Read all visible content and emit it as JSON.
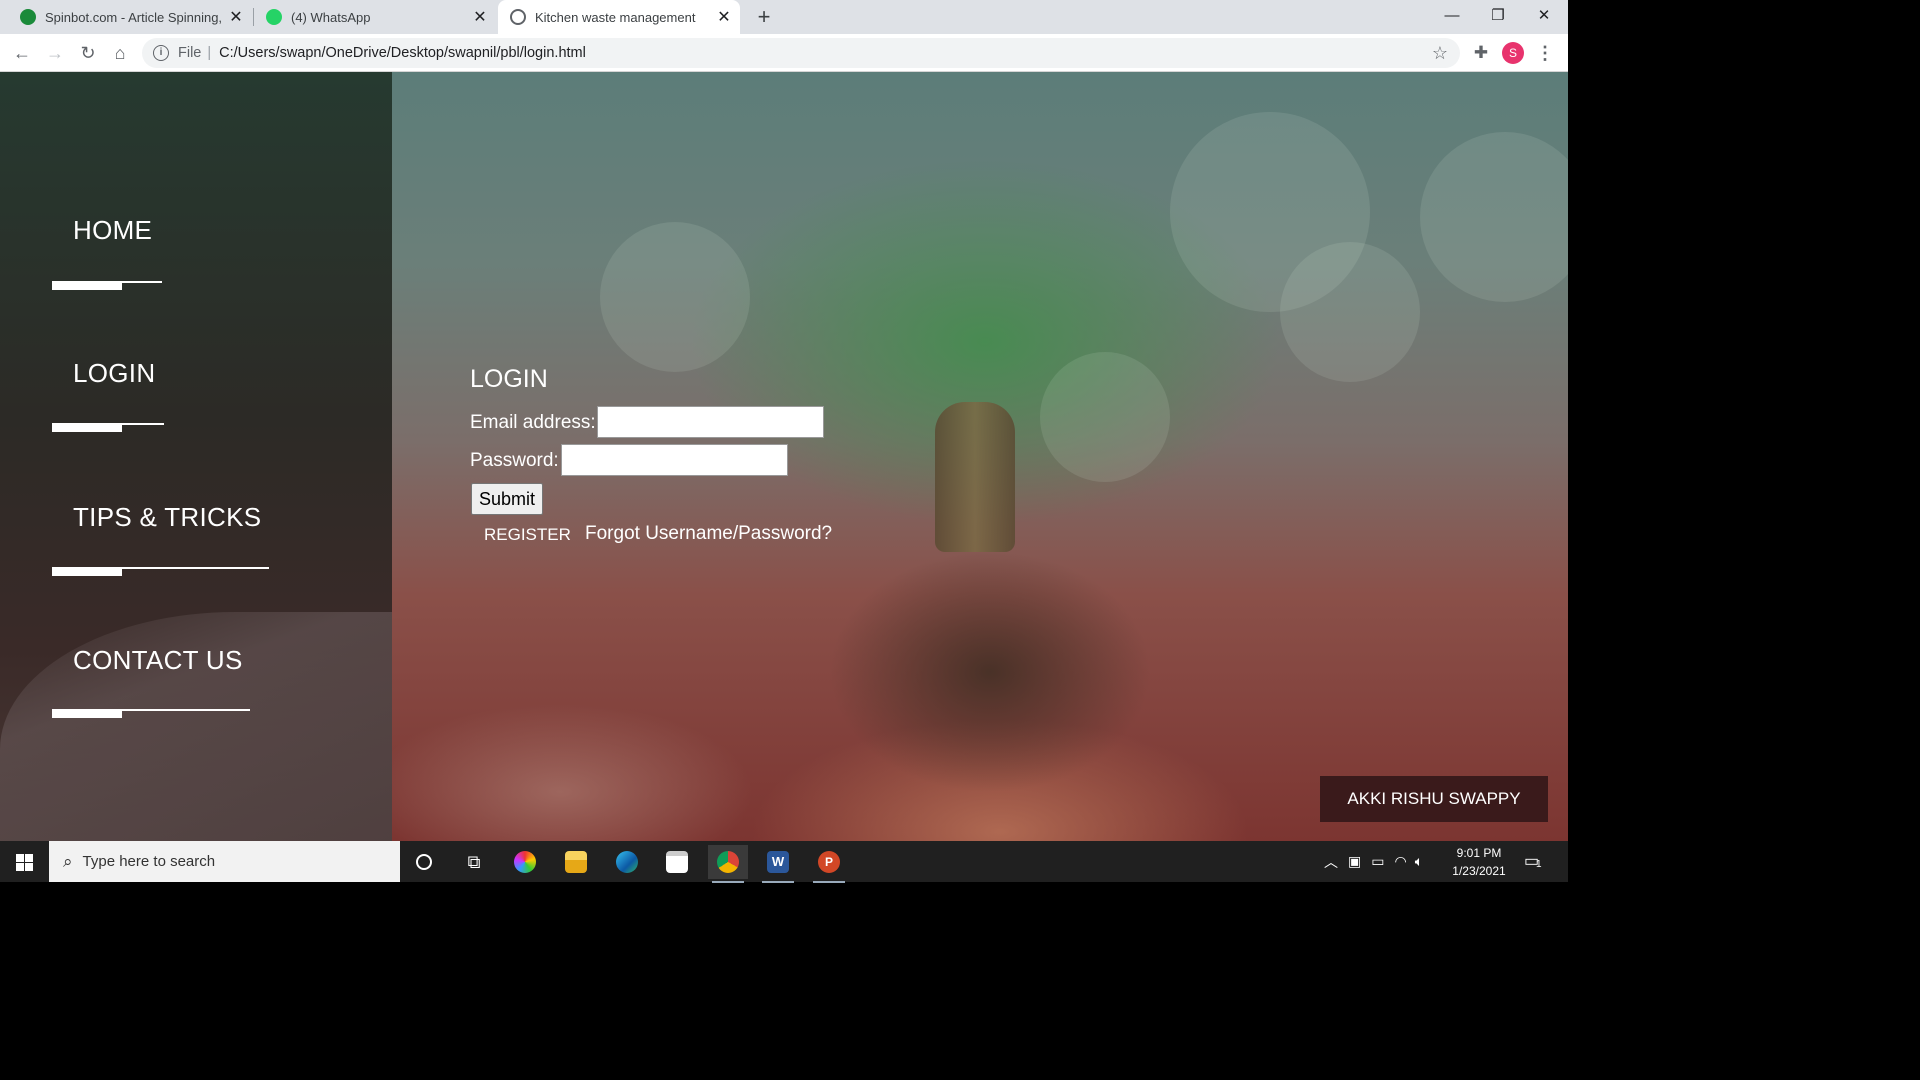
{
  "browser": {
    "tabs": [
      {
        "title": "Spinbot.com - Article Spinning, T",
        "active": false
      },
      {
        "title": "(4) WhatsApp",
        "active": false
      },
      {
        "title": "Kitchen waste management",
        "active": true
      }
    ],
    "new_tab_label": "+",
    "url_scheme_label": "File",
    "url": "C:/Users/swapn/OneDrive/Desktop/swapnil/pbl/login.html",
    "profile_initial": "S"
  },
  "page": {
    "nav": {
      "home": "HOME",
      "login": "LOGIN",
      "tips": "TIPS & TRICKS",
      "contact": "CONTACT US"
    },
    "login_form": {
      "title": "LOGIN",
      "email_label": "Email address:",
      "email_value": "",
      "password_label": "Password:",
      "password_value": "",
      "submit_label": "Submit",
      "register_link": "REGISTER",
      "forgot_link": "Forgot Username/Password?"
    },
    "credit": "AKKI RISHU SWAPPY"
  },
  "taskbar": {
    "search_placeholder": "Type here to search",
    "time": "9:01 PM",
    "date": "1/23/2021",
    "notification_count": "1"
  },
  "colors": {
    "sidebar_bg": "#2c2a26",
    "credit_bg": "#3a1a1b",
    "profile_bg": "#e8336d",
    "taskbar_bg": "#202020"
  }
}
